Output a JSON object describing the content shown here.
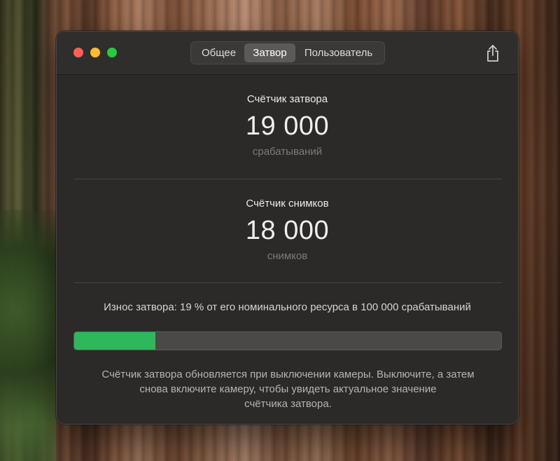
{
  "window": {
    "tabs": [
      {
        "label": "Общее",
        "active": false
      },
      {
        "label": "Затвор",
        "active": true
      },
      {
        "label": "Пользователь",
        "active": false
      }
    ],
    "share_icon": "share-icon"
  },
  "shutter": {
    "title": "Счётчик затвора",
    "value": "19 000",
    "unit": "срабатываний"
  },
  "shots": {
    "title": "Счётчик снимков",
    "value": "18 000",
    "unit": "снимков"
  },
  "wear": {
    "text": "Износ затвора: 19 % от его номинального ресурса в 100 000 срабатываний",
    "percent": 19,
    "fill_color": "#2db85b"
  },
  "note": {
    "line1": "Счётчик затвора обновляется при выключении камеры. Выключите, а затем",
    "line2": "снова включите камеру, чтобы увидеть актуальное значение",
    "line3": "счётчика затвора."
  },
  "colors": {
    "close": "#fe5f57",
    "minimize": "#febc2e",
    "maximize": "#28c840"
  }
}
